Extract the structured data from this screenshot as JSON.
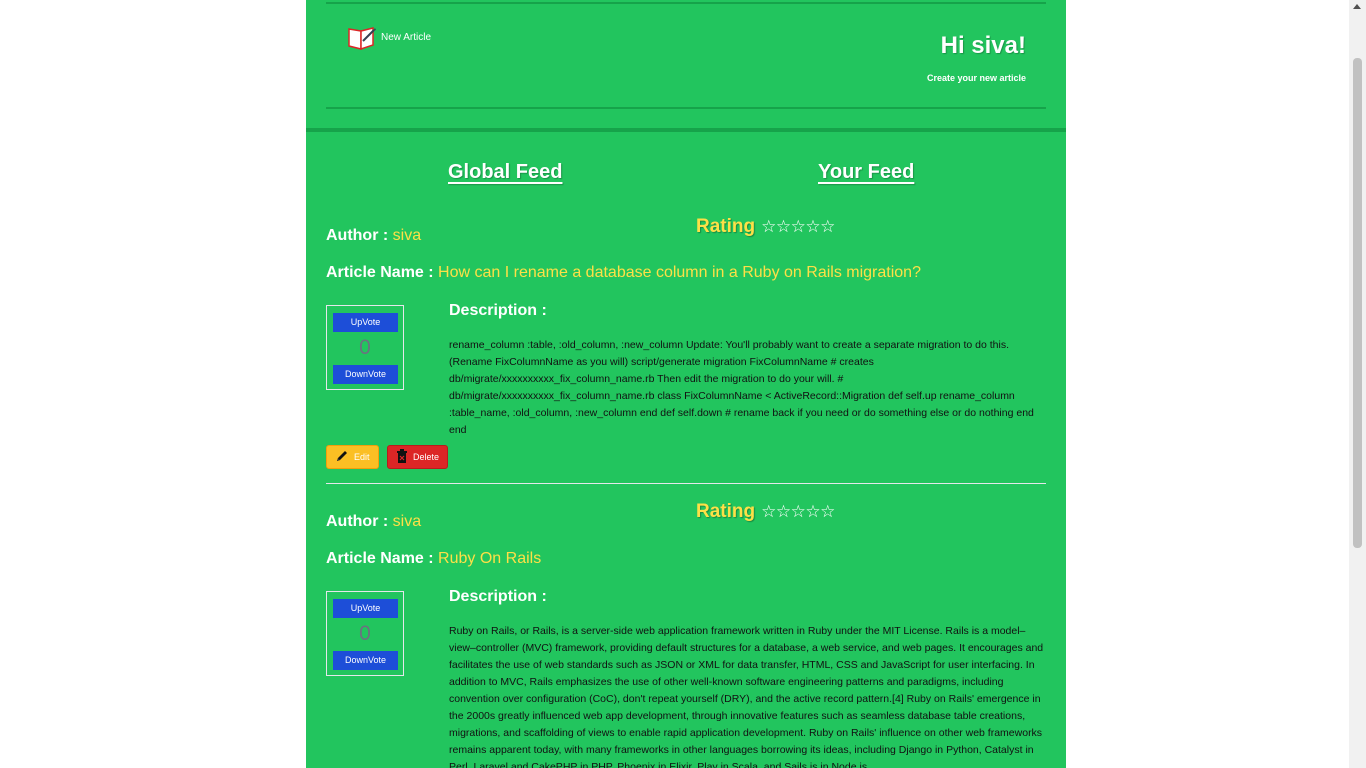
{
  "header": {
    "new_article_label": "New Article",
    "greeting": "Hi siva!",
    "subtitle": "Create your new article"
  },
  "feeds": {
    "global": "Global Feed",
    "yours": "Your Feed"
  },
  "labels": {
    "author": "Author :",
    "article_name": "Article Name :",
    "rating": "Rating",
    "description": "Description :",
    "upvote": "UpVote",
    "downvote": "DownVote",
    "edit": "Edit",
    "delete": "Delete"
  },
  "articles": [
    {
      "author": "siva",
      "name": "How can I rename a database column in a Ruby on Rails migration?",
      "stars": "☆☆☆☆☆",
      "votes": "0",
      "description": "rename_column :table, :old_column, :new_column Update: You'll probably want to create a separate migration to do this. (Rename FixColumnName as you will) script/generate migration FixColumnName # creates db/migrate/xxxxxxxxxx_fix_column_name.rb Then edit the migration to do your will. # db/migrate/xxxxxxxxxx_fix_column_name.rb class FixColumnName < ActiveRecord::Migration def self.up rename_column :table_name, :old_column, :new_column end def self.down # rename back if you need or do something else or do nothing end end"
    },
    {
      "author": "siva",
      "name": "Ruby On Rails",
      "stars": "☆☆☆☆☆",
      "votes": "0",
      "description": "Ruby on Rails, or Rails, is a server-side web application framework written in Ruby under the MIT License. Rails is a model–view–controller (MVC) framework, providing default structures for a database, a web service, and web pages. It encourages and facilitates the use of web standards such as JSON or XML for data transfer, HTML, CSS and JavaScript for user interfacing. In addition to MVC, Rails emphasizes the use of other well-known software engineering patterns and paradigms, including convention over configuration (CoC), don't repeat yourself (DRY), and the active record pattern.[4] Ruby on Rails' emergence in the 2000s greatly influenced web app development, through innovative features such as seamless database table creations, migrations, and scaffolding of views to enable rapid application development. Ruby on Rails' influence on other web frameworks remains apparent today, with many frameworks in other languages borrowing its ideas, including Django in Python, Catalyst in Perl, Laravel and CakePHP in PHP, Phoenix in Elixir, Play in Scala, and Sails.js in Node.js."
    }
  ],
  "colors": {
    "page_bg": "#22c55e",
    "accent_yellow": "#fde047",
    "vote_blue": "#1d4ed8",
    "edit": "#fbbf24",
    "delete": "#dc2626"
  }
}
